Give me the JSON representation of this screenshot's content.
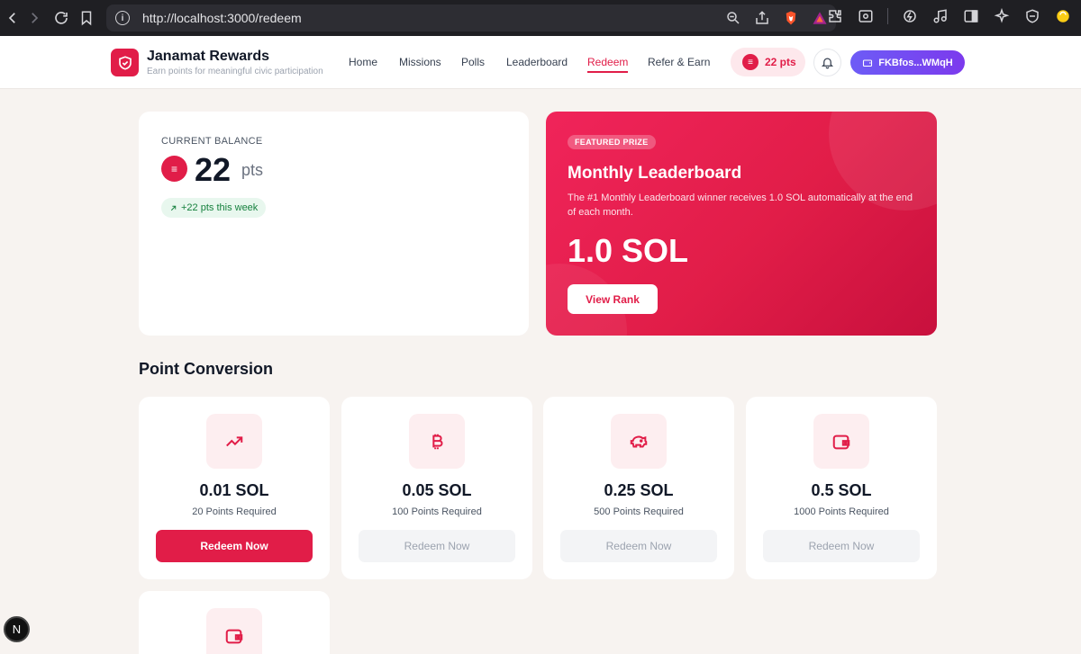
{
  "browser": {
    "url": "http://localhost:3000/redeem"
  },
  "header": {
    "brand_title": "Janamat Rewards",
    "brand_subtitle": "Earn points for meaningful civic participation",
    "nav": [
      "Home",
      "Missions",
      "Polls",
      "Leaderboard",
      "Redeem",
      "Refer & Earn"
    ],
    "active_nav": "Redeem",
    "points_pill": "22 pts",
    "coin_glyph": "≡",
    "wallet": "FKBfos...WMqH"
  },
  "balance": {
    "label": "CURRENT BALANCE",
    "value": "22",
    "unit": "pts",
    "week_change": "+22 pts this week"
  },
  "featured": {
    "badge": "FEATURED PRIZE",
    "title": "Monthly Leaderboard",
    "description": "The #1 Monthly Leaderboard winner receives 1.0 SOL automatically at the end of each month.",
    "amount": "1.0 SOL",
    "button": "View Rank"
  },
  "conversion": {
    "title": "Point Conversion",
    "tiles": [
      {
        "amount": "0.01 SOL",
        "required": "20 Points Required",
        "button": "Redeem Now",
        "enabled": true,
        "icon": "trending-up-icon"
      },
      {
        "amount": "0.05 SOL",
        "required": "100 Points Required",
        "button": "Redeem Now",
        "enabled": false,
        "icon": "bitcoin-icon"
      },
      {
        "amount": "0.25 SOL",
        "required": "500 Points Required",
        "button": "Redeem Now",
        "enabled": false,
        "icon": "piggy-bank-icon"
      },
      {
        "amount": "0.5 SOL",
        "required": "1000 Points Required",
        "button": "Redeem Now",
        "enabled": false,
        "icon": "wallet-icon"
      },
      {
        "amount": "",
        "required": "",
        "button": "",
        "enabled": false,
        "icon": "wallet-icon"
      }
    ]
  },
  "colors": {
    "accent": "#e11d48",
    "wallet_button": "#6d5cf6",
    "background": "#f7f3f0"
  },
  "dev_badge": "N"
}
